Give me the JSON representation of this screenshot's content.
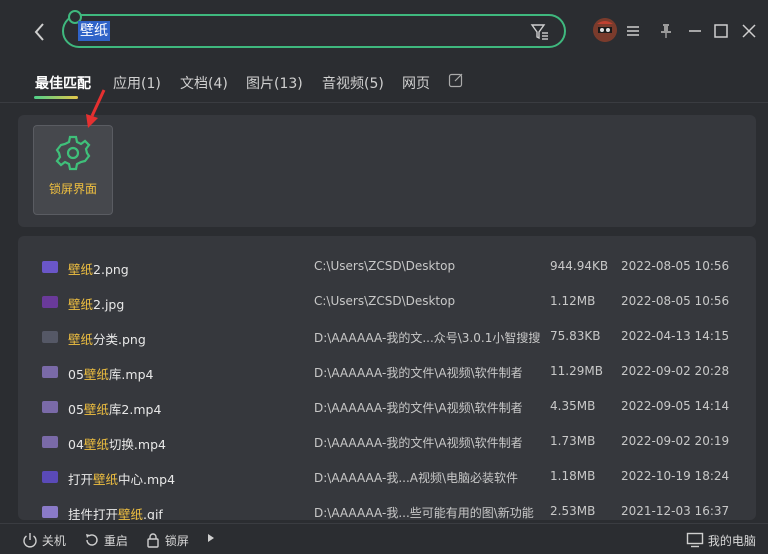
{
  "search": {
    "value": "壁纸"
  },
  "tabs": [
    {
      "label": "最佳匹配"
    },
    {
      "label": "应用(1)"
    },
    {
      "label": "文档(4)"
    },
    {
      "label": "图片(13)"
    },
    {
      "label": "音视频(5)"
    },
    {
      "label": "网页"
    }
  ],
  "best_match": {
    "app_label": "锁屏界面"
  },
  "files": [
    {
      "pre": "",
      "hl": "壁纸",
      "post": "2.png",
      "path": "C:\\Users\\ZCSD\\Desktop",
      "size": "944.94KB",
      "date": "2022-08-05 10:56"
    },
    {
      "pre": "",
      "hl": "壁纸",
      "post": "2.jpg",
      "path": "C:\\Users\\ZCSD\\Desktop",
      "size": "1.12MB",
      "date": "2022-08-05 10:56"
    },
    {
      "pre": "",
      "hl": "壁纸",
      "post": "分类.png",
      "path": "D:\\AAAAAA-我的文...众号\\3.0.1小智搜搜",
      "size": "75.83KB",
      "date": "2022-04-13 14:15"
    },
    {
      "pre": "05",
      "hl": "壁纸",
      "post": "库.mp4",
      "path": "D:\\AAAAAA-我的文件\\A视频\\软件制者",
      "size": "11.29MB",
      "date": "2022-09-02 20:28"
    },
    {
      "pre": "05",
      "hl": "壁纸",
      "post": "库2.mp4",
      "path": "D:\\AAAAAA-我的文件\\A视频\\软件制者",
      "size": "4.35MB",
      "date": "2022-09-05 14:14"
    },
    {
      "pre": "04",
      "hl": "壁纸",
      "post": "切换.mp4",
      "path": "D:\\AAAAAA-我的文件\\A视频\\软件制者",
      "size": "1.73MB",
      "date": "2022-09-02 20:19"
    },
    {
      "pre": "打开",
      "hl": "壁纸",
      "post": "中心.mp4",
      "path": "D:\\AAAAAA-我...A视频\\电脑必装软件",
      "size": "1.18MB",
      "date": "2022-10-19 18:24"
    },
    {
      "pre": "挂件打开",
      "hl": "壁纸",
      "post": ".gif",
      "path": "D:\\AAAAAA-我...些可能有用的图\\新功能",
      "size": "2.53MB",
      "date": "2021-12-03 16:37"
    }
  ],
  "bottom": {
    "shutdown": "关机",
    "restart": "重启",
    "lock": "锁屏",
    "my_computer": "我的电脑"
  },
  "colors": {
    "accent": "#3fb87e",
    "highlight": "#f0c040"
  }
}
